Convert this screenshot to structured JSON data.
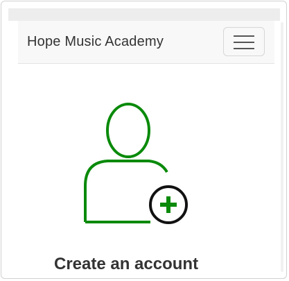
{
  "navbar": {
    "brand": "Hope Music Academy",
    "toggle_icon": "hamburger-menu-icon"
  },
  "main": {
    "hero_icon": "add-user-icon",
    "heading": "Create an account",
    "subtext": ""
  },
  "colors": {
    "accent_green": "#0a8a0a",
    "navbar_bg": "#f8f8f8",
    "text": "#333333"
  }
}
